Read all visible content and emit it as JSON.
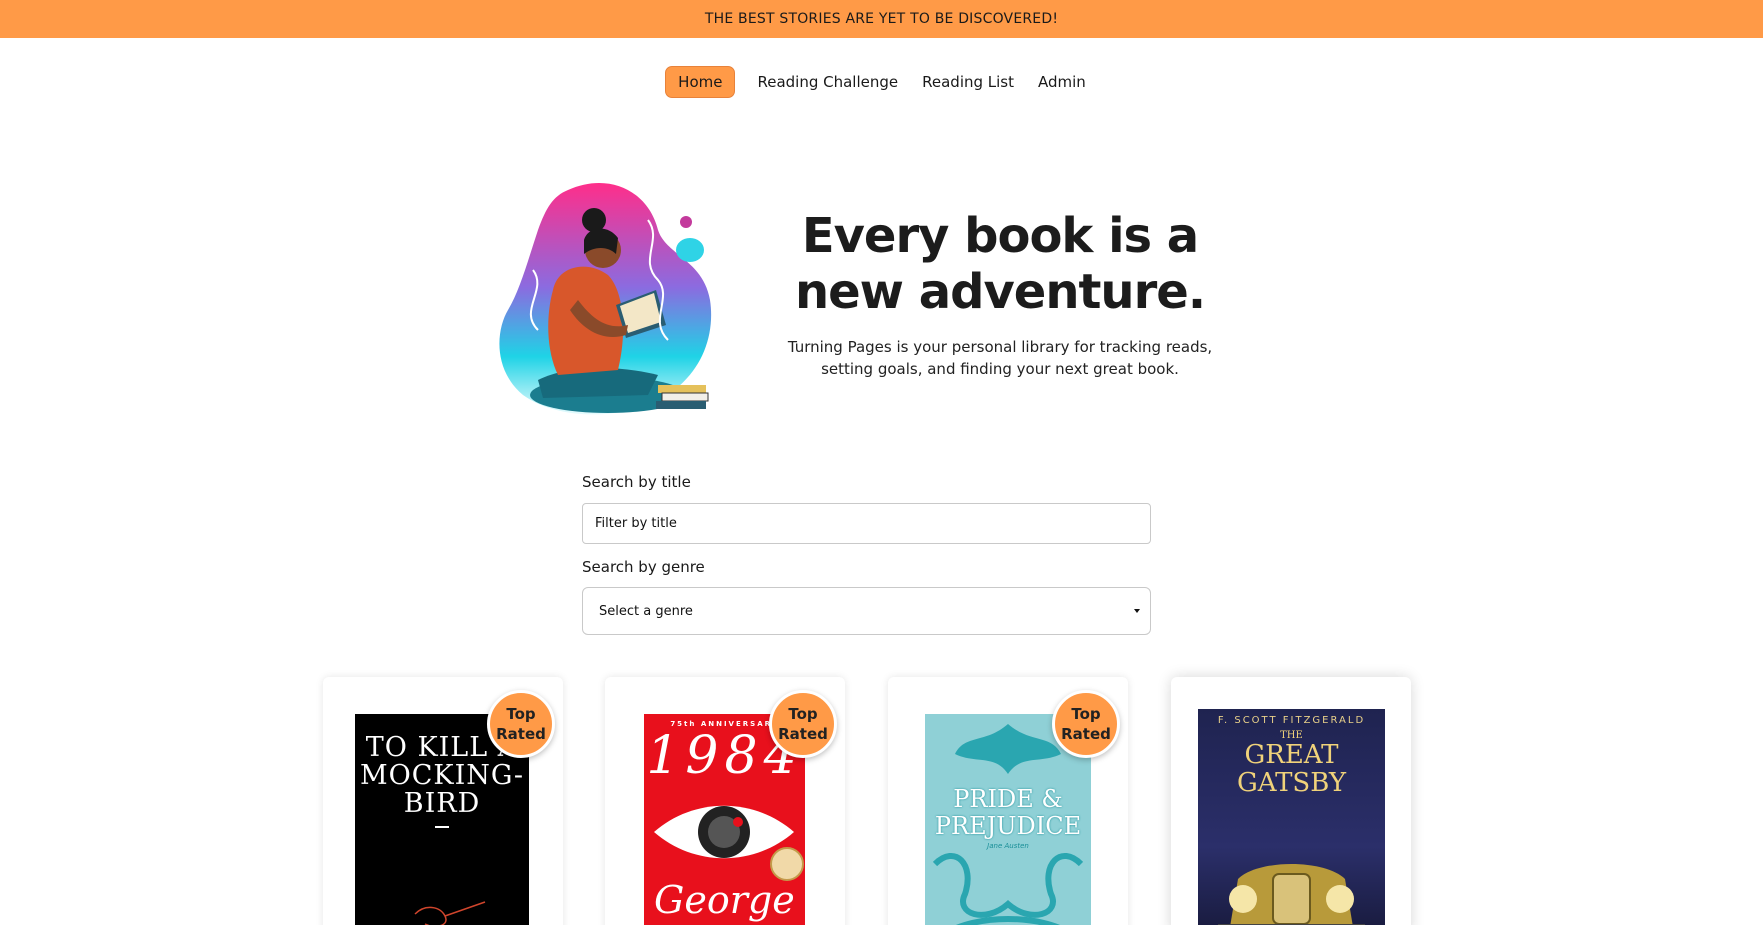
{
  "banner": {
    "text": "THE BEST STORIES ARE YET TO BE DISCOVERED!"
  },
  "nav": {
    "items": [
      {
        "label": "Home",
        "active": true
      },
      {
        "label": "Reading Challenge",
        "active": false
      },
      {
        "label": "Reading List",
        "active": false
      },
      {
        "label": "Admin",
        "active": false
      }
    ]
  },
  "hero": {
    "title_line1": "Every book is a",
    "title_line2": "new adventure.",
    "subtitle": "Turning Pages is your personal library for tracking reads, setting goals, and finding your next great book.",
    "illustration": "woman-reading-book-illustration"
  },
  "search": {
    "title_label": "Search by title",
    "title_placeholder": "Filter by title",
    "genre_label": "Search by genre",
    "genre_selected": "Select a genre"
  },
  "books": [
    {
      "cover_text": [
        "TO KILL A",
        "MOCKING-",
        "BIRD"
      ],
      "badge": [
        "Top",
        "Rated"
      ],
      "cover_color": "#000000"
    },
    {
      "cover_top": "75th ANNIVERSARY",
      "cover_title": "1984",
      "cover_author": "George",
      "badge": [
        "Top",
        "Rated"
      ],
      "cover_color": "#e8101c"
    },
    {
      "cover_title_line1": "PRIDE &",
      "cover_title_line2": "PREJUDICE",
      "cover_author": "Jane Austen",
      "badge": [
        "Top",
        "Rated"
      ],
      "cover_color": "#8fd0d6"
    },
    {
      "cover_author": "F. SCOTT FITZGERALD",
      "cover_title_line1": "THE",
      "cover_title_line2": "GREAT",
      "cover_title_line3": "GATSBY",
      "cover_color": "#1f2350"
    }
  ],
  "colors": {
    "accent": "#ff9a47"
  }
}
